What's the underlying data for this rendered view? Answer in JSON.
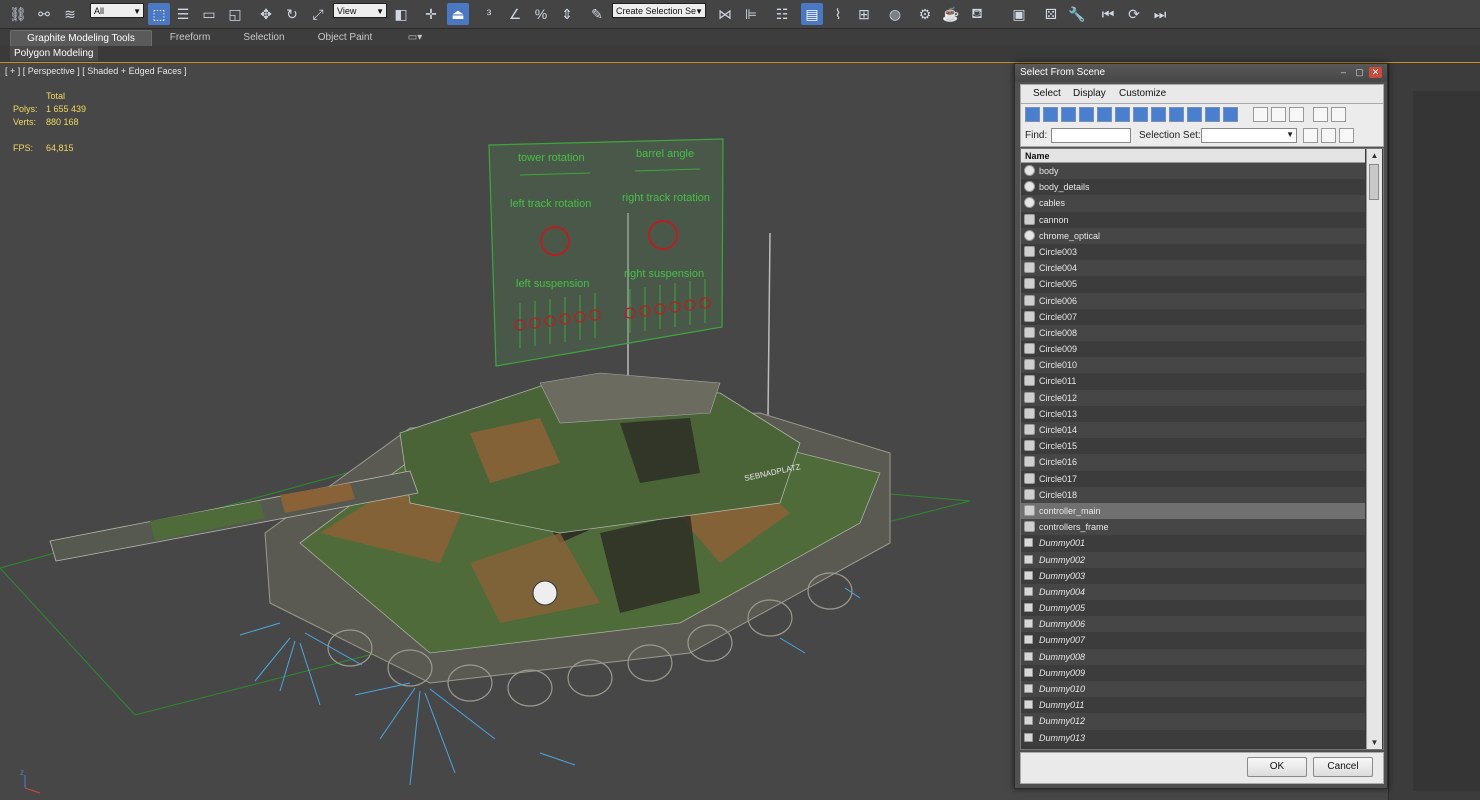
{
  "toolbar": {
    "filter_value": "All",
    "ref_coord_value": "View",
    "selection_set_placeholder": "Create Selection Se",
    "colors": {
      "active": "#4b78c2"
    }
  },
  "ribbon": {
    "tabs": [
      "Graphite Modeling Tools",
      "Freeform",
      "Selection",
      "Object Paint"
    ],
    "sub_tab": "Polygon Modeling"
  },
  "viewport": {
    "label": "[ + ] [ Perspective ] [ Shaded + Edged Faces ]",
    "stats": {
      "total_label": "Total",
      "polys_label": "Polys:",
      "polys_value": "1 655 439",
      "verts_label": "Verts:",
      "verts_value": "880 168",
      "fps_label": "FPS:",
      "fps_value": "64,815"
    },
    "controller_panel": {
      "tower_rotation": "tower rotation",
      "barrel_angle": "barrel angle",
      "left_track_rotation": "left track rotation",
      "right_track_rotation": "right track rotation",
      "left_suspension": "left suspension",
      "right_suspension": "right suspension"
    },
    "tank_text": "SEBNADPLATZ"
  },
  "dialog": {
    "title": "Select From Scene",
    "menu": [
      "Select",
      "Display",
      "Customize"
    ],
    "find_label": "Find:",
    "find_value": "",
    "selection_set_label": "Selection Set:",
    "selection_set_value": "",
    "column_name": "Name",
    "items": [
      {
        "name": "body",
        "type": "object",
        "italic": false
      },
      {
        "name": "body_details",
        "type": "object",
        "italic": false
      },
      {
        "name": "cables",
        "type": "object",
        "italic": false
      },
      {
        "name": "cannon",
        "type": "shape",
        "italic": false
      },
      {
        "name": "chrome_optical",
        "type": "object",
        "italic": false
      },
      {
        "name": "Circle003",
        "type": "shape",
        "italic": false
      },
      {
        "name": "Circle004",
        "type": "shape",
        "italic": false
      },
      {
        "name": "Circle005",
        "type": "shape",
        "italic": false
      },
      {
        "name": "Circle006",
        "type": "shape",
        "italic": false
      },
      {
        "name": "Circle007",
        "type": "shape",
        "italic": false
      },
      {
        "name": "Circle008",
        "type": "shape",
        "italic": false
      },
      {
        "name": "Circle009",
        "type": "shape",
        "italic": false
      },
      {
        "name": "Circle010",
        "type": "shape",
        "italic": false
      },
      {
        "name": "Circle011",
        "type": "shape",
        "italic": false
      },
      {
        "name": "Circle012",
        "type": "shape",
        "italic": false
      },
      {
        "name": "Circle013",
        "type": "shape",
        "italic": false
      },
      {
        "name": "Circle014",
        "type": "shape",
        "italic": false
      },
      {
        "name": "Circle015",
        "type": "shape",
        "italic": false
      },
      {
        "name": "Circle016",
        "type": "shape",
        "italic": false
      },
      {
        "name": "Circle017",
        "type": "shape",
        "italic": false
      },
      {
        "name": "Circle018",
        "type": "shape",
        "italic": false
      },
      {
        "name": "controller_main",
        "type": "shape",
        "italic": false,
        "selected": true
      },
      {
        "name": "controllers_frame",
        "type": "shape",
        "italic": false
      },
      {
        "name": "Dummy001",
        "type": "dummy",
        "italic": true
      },
      {
        "name": "Dummy002",
        "type": "dummy",
        "italic": true
      },
      {
        "name": "Dummy003",
        "type": "dummy",
        "italic": true
      },
      {
        "name": "Dummy004",
        "type": "dummy",
        "italic": true
      },
      {
        "name": "Dummy005",
        "type": "dummy",
        "italic": true
      },
      {
        "name": "Dummy006",
        "type": "dummy",
        "italic": true
      },
      {
        "name": "Dummy007",
        "type": "dummy",
        "italic": true
      },
      {
        "name": "Dummy008",
        "type": "dummy",
        "italic": true
      },
      {
        "name": "Dummy009",
        "type": "dummy",
        "italic": true
      },
      {
        "name": "Dummy010",
        "type": "dummy",
        "italic": true
      },
      {
        "name": "Dummy011",
        "type": "dummy",
        "italic": true
      },
      {
        "name": "Dummy012",
        "type": "dummy",
        "italic": true
      },
      {
        "name": "Dummy013",
        "type": "dummy",
        "italic": true
      }
    ],
    "ok_label": "OK",
    "cancel_label": "Cancel"
  }
}
